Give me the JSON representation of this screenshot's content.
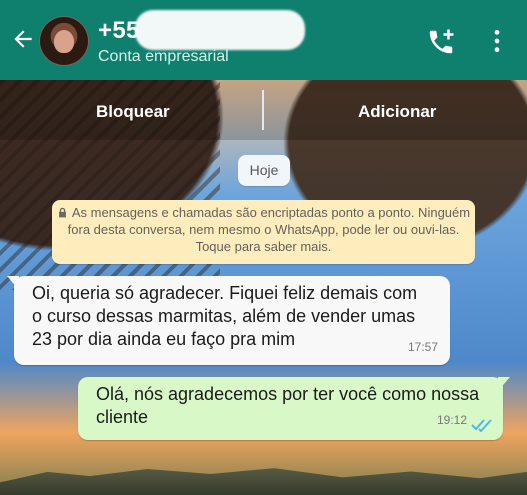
{
  "header": {
    "title": "+55",
    "subtitle": "Conta empresarial"
  },
  "actions": {
    "block": "Bloquear",
    "add": "Adicionar"
  },
  "chat": {
    "date": "Hoje",
    "encryption": "As mensagens e chamadas são encriptadas ponto a ponto. Ninguém fora desta conversa, nem mesmo o WhatsApp, pode ler ou ouvi-las. Toque para saber mais.",
    "messages": [
      {
        "text": "Oi, queria só agradecer. Fiquei feliz demais com o curso dessas marmitas, além de vender umas 23 por dia ainda eu faço pra mim",
        "time": "17:57"
      },
      {
        "text": "Olá, nós agradecemos por ter você como nossa cliente",
        "time": "19:12"
      }
    ]
  },
  "colors": {
    "header": "#0f7f6e",
    "incoming_bubble": "#f8f8f8",
    "outgoing_bubble": "#d9f8c8",
    "encryption_notice": "#ffedbd",
    "read_ticks": "#4fb6ec"
  },
  "icons": [
    "back-arrow-icon",
    "phone-add-icon",
    "more-options-icon",
    "lock-icon",
    "double-check-icon"
  ]
}
